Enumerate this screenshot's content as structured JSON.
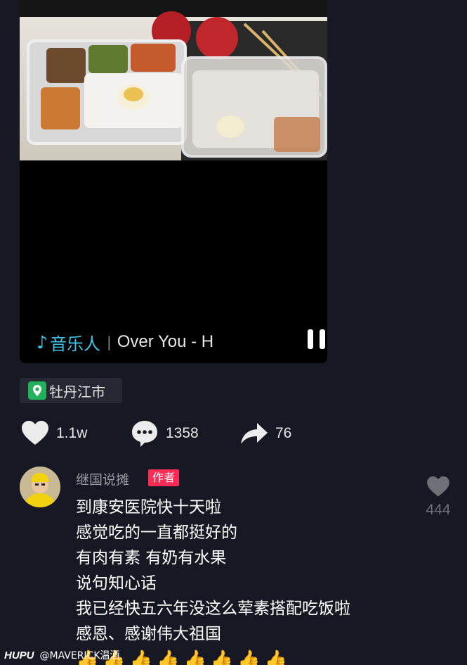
{
  "video": {
    "music_icon": "music-note-icon",
    "music_label": "音乐人",
    "music_separator": "|",
    "song_title": "Over You - H",
    "pause_icon": "pause-icon"
  },
  "location": {
    "icon": "location-pin-icon",
    "name": "牡丹江市"
  },
  "actions": {
    "like_count": "1.1w",
    "comment_count": "1358",
    "share_count": "76"
  },
  "comment": {
    "author": "继国说摊",
    "badge": "作者",
    "lines": [
      "到康安医院快十天啦",
      "感觉吃的一直都挺好的",
      "有肉有素 有奶有水果",
      "说句知心话",
      "我已经快五六年没这么荤素搭配吃饭啦",
      "感恩、感谢伟大祖国"
    ],
    "thumbs": [
      "👍",
      "👍",
      "👍",
      "👍",
      "👍",
      "👍",
      "👍",
      "👍"
    ],
    "like_count": "444"
  },
  "watermark": {
    "brand": "HUPU",
    "user": "@MAVERICK温酒"
  },
  "colors": {
    "background": "#161823",
    "accent_music": "#3ec5e8",
    "badge": "#fe2c55"
  }
}
